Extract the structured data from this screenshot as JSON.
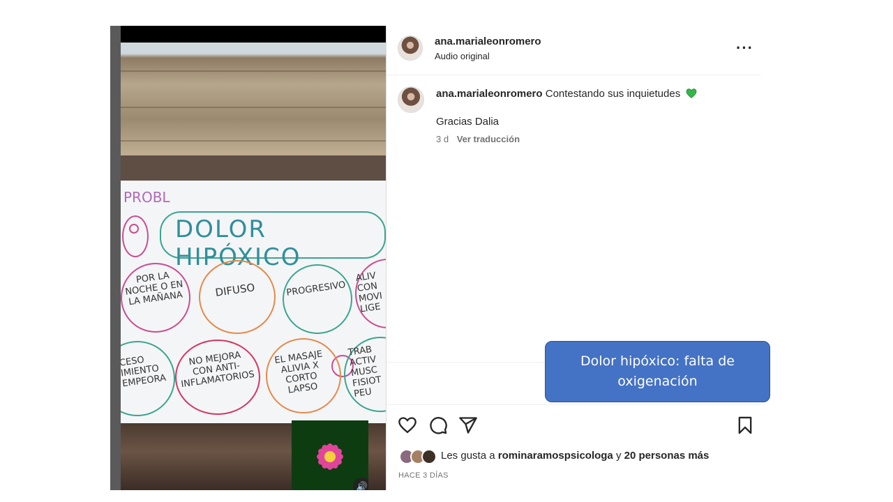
{
  "media": {
    "poster_title": "DOLOR HIPÓXICO",
    "poster_fragment": "PROBL",
    "circles": [
      {
        "text": "POR LA NOCHE O EN LA MAÑANA",
        "color": "#c94d8f"
      },
      {
        "text": "DIFUSO",
        "color": "#e48a4a"
      },
      {
        "text": "PROGRESIVO",
        "color": "#3aa58f"
      },
      {
        "text": "ALIV CON MOVI LIGE",
        "color": "#c94d8f"
      },
      {
        "text": "CESO IMIENTO EMPEORA",
        "color": "#3aa58f"
      },
      {
        "text": "NO MEJORA CON ANTI-INFLAMATORIOS",
        "color": "#d2375f"
      },
      {
        "text": "EL MASAJE ALIVIA X CORTO LAPSO",
        "color": "#e48a4a"
      },
      {
        "text": "TRAB ACTIV MUSC FISIOT PEU",
        "color": "#3aa58f"
      }
    ],
    "sound_icon": "speaker-icon"
  },
  "post": {
    "username": "ana.marialeonromero",
    "audio_label": "Audio original",
    "more_icon": "ellipsis-icon"
  },
  "comment": {
    "username": "ana.marialeonromero",
    "text": "Contestando sus inquietudes",
    "emoji": "green-heart",
    "line2": "Gracias Dalia",
    "time": "3 d",
    "translate_link": "Ver traducción"
  },
  "actions": {
    "like_icon": "heart-icon",
    "comment_icon": "comment-icon",
    "share_icon": "send-icon",
    "save_icon": "bookmark-icon"
  },
  "likes": {
    "prefix": "Les gusta a",
    "user": "rominaramospsicologa",
    "connector": "y",
    "others": "20 personas más"
  },
  "timestamp": "HACE 3 DÍAS",
  "callout": {
    "text": "Dolor hipóxico: falta de oxigenación"
  },
  "colors": {
    "callout_bg": "#4472c4",
    "accent_green": "#3aa58f",
    "heart_green": "#35b64a",
    "muted_text": "#737373"
  }
}
